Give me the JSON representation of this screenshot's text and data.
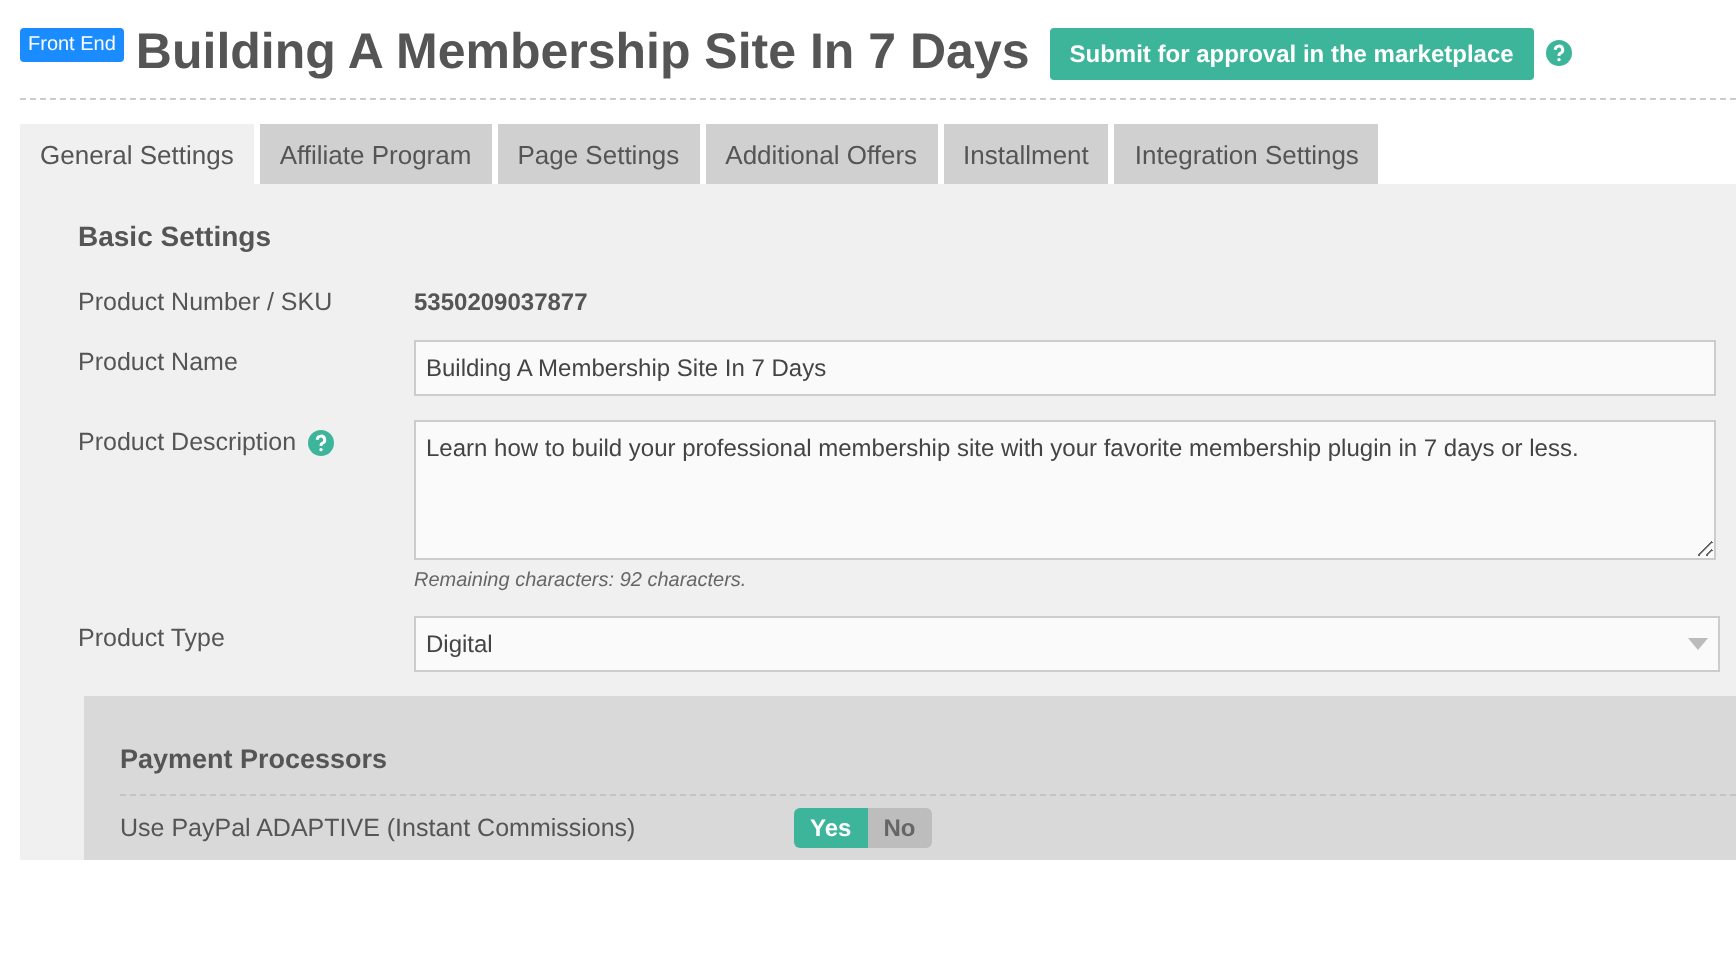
{
  "header": {
    "badge": "Front End",
    "title": "Building A Membership Site In 7 Days",
    "submit_button": "Submit for approval in the marketplace"
  },
  "tabs": [
    {
      "label": "General Settings",
      "selected": true
    },
    {
      "label": "Affiliate Program",
      "selected": false
    },
    {
      "label": "Page Settings",
      "selected": false
    },
    {
      "label": "Additional Offers",
      "selected": false
    },
    {
      "label": "Installment",
      "selected": false
    },
    {
      "label": "Integration Settings",
      "selected": false
    }
  ],
  "basic_settings": {
    "heading": "Basic Settings",
    "fields": [
      {
        "kind": "text",
        "label": "Product Number / SKU",
        "value": "5350209037877"
      },
      {
        "kind": "input",
        "label": "Product Name",
        "value": "Building A Membership Site In 7 Days"
      },
      {
        "kind": "textarea",
        "label": "Product Description",
        "help": true,
        "value": "Learn how to build your professional membership site with your favorite membership plugin in 7 days or less.",
        "note": "Remaining characters: 92 characters."
      },
      {
        "kind": "select",
        "label": "Product Type",
        "value": "Digital"
      }
    ]
  },
  "payment_processors": {
    "heading": "Payment Processors",
    "rows": [
      {
        "label": "Use PayPal ADAPTIVE (Instant Commissions)",
        "options": [
          {
            "label": "Yes",
            "selected": true
          },
          {
            "label": "No",
            "selected": false
          }
        ]
      }
    ]
  }
}
